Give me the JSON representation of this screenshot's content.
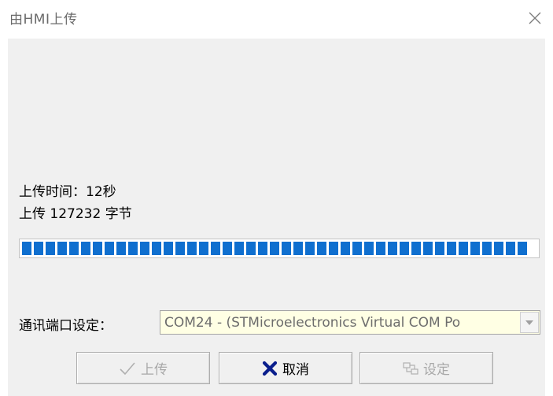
{
  "window": {
    "title": "由HMI上传",
    "close_icon": "close-icon"
  },
  "status": {
    "time_text": "上传时间：12秒",
    "bytes_text": "上传 127232 字节"
  },
  "progress": {
    "fraction": 1.0,
    "color": "#0f6fcf"
  },
  "port": {
    "label": "通讯端口设定：",
    "selected_value": "COM24 - (STMicroelectronics Virtual COM Po",
    "dropdown_icon": "chevron-down-icon"
  },
  "buttons": {
    "upload": {
      "label": "上传",
      "icon": "check-icon",
      "enabled": false
    },
    "cancel": {
      "label": "取消",
      "icon": "x-mark-icon",
      "enabled": true,
      "icon_color": "#0a1e8c"
    },
    "settings": {
      "label": "设定",
      "icon": "network-icon",
      "enabled": false
    }
  }
}
